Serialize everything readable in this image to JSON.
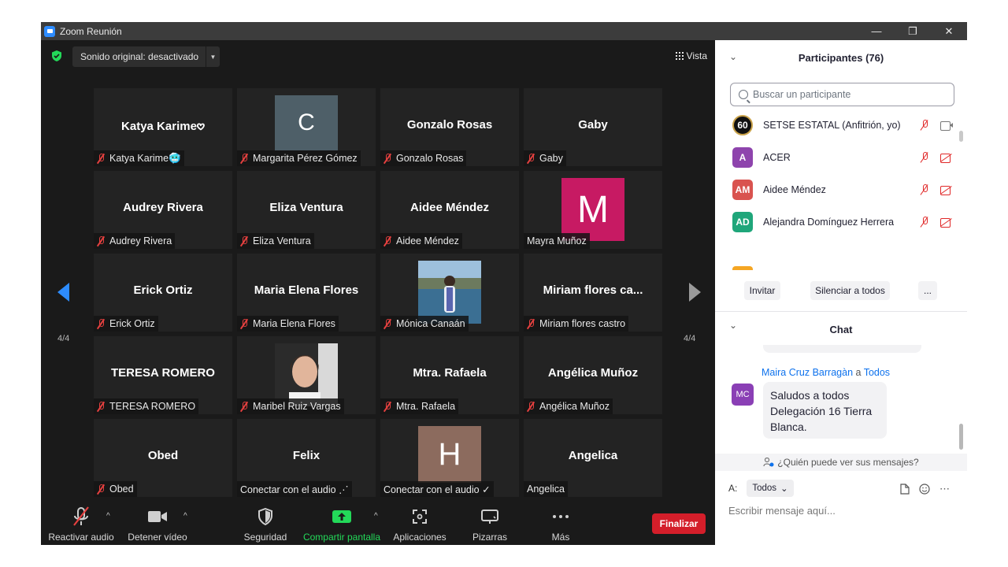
{
  "window": {
    "title": "Zoom Reunión",
    "controls": [
      "—",
      "❐",
      "✕"
    ]
  },
  "topbar": {
    "sound_label": "Sonido original: desactivado",
    "view_label": "Vista"
  },
  "grid": {
    "tiles": [
      {
        "name": "Katya Karime𖹭",
        "label": "Katya Karime🥶",
        "muted": true,
        "kind": "text"
      },
      {
        "name": "",
        "label": "Margarita Pérez Gómez",
        "muted": true,
        "kind": "avatar",
        "letter": "C",
        "color": "#4e5f68"
      },
      {
        "name": "Gonzalo Rosas",
        "label": "Gonzalo Rosas",
        "muted": true,
        "kind": "text"
      },
      {
        "name": "Gaby",
        "label": "Gaby",
        "muted": true,
        "kind": "text"
      },
      {
        "name": "Audrey Rivera",
        "label": "Audrey Rivera",
        "muted": true,
        "kind": "text"
      },
      {
        "name": "Eliza Ventura",
        "label": "Eliza Ventura",
        "muted": true,
        "kind": "text"
      },
      {
        "name": "Aidee Méndez",
        "label": "Aidee Méndez",
        "muted": true,
        "kind": "text"
      },
      {
        "name": "",
        "label": "Mayra Muñoz",
        "muted": false,
        "kind": "avatar",
        "letter": "M",
        "color": "#c71a63"
      },
      {
        "name": "Erick Ortiz",
        "label": "Erick Ortiz",
        "muted": true,
        "kind": "text"
      },
      {
        "name": "Maria Elena Flores",
        "label": "Maria Elena Flores",
        "muted": true,
        "kind": "text"
      },
      {
        "name": "",
        "label": "Mónica Canaán",
        "muted": true,
        "kind": "photo-lake"
      },
      {
        "name": "Miriam flores ca...",
        "label": "Miriam flores castro",
        "muted": true,
        "kind": "text"
      },
      {
        "name": "TERESA ROMERO",
        "label": "TERESA ROMERO",
        "muted": true,
        "kind": "text"
      },
      {
        "name": "",
        "label": "Maribel Ruiz Vargas",
        "muted": true,
        "kind": "photo-face"
      },
      {
        "name": "Mtra. Rafaela",
        "label": "Mtra. Rafaela",
        "muted": true,
        "kind": "text"
      },
      {
        "name": "Angélica Muñoz",
        "label": "Angélica Muñoz",
        "muted": true,
        "kind": "text"
      },
      {
        "name": "Obed",
        "label": "Obed",
        "muted": true,
        "kind": "text"
      },
      {
        "name": "Felix",
        "label": "Conectar con el audio ⋰",
        "muted": false,
        "kind": "text"
      },
      {
        "name": "",
        "label": "Conectar con el audio ✓",
        "muted": false,
        "kind": "avatar",
        "letter": "H",
        "color": "#8c6b5e"
      },
      {
        "name": "Angelica",
        "label": "Angelica",
        "muted": false,
        "kind": "text"
      }
    ],
    "page_left": "4/4",
    "page_right": "4/4"
  },
  "toolbar": {
    "audio": "Reactivar audio",
    "video": "Detener vídeo",
    "security": "Seguridad",
    "share": "Compartir pantalla",
    "apps": "Aplicaciones",
    "whiteboards": "Pizarras",
    "more": "Más",
    "end": "Finalizar"
  },
  "participants": {
    "title": "Participantes (76)",
    "search_placeholder": "Buscar un participante",
    "list": [
      {
        "initials": "60",
        "name": "SETSE ESTATAL (Anfitrión, yo)",
        "color": "#111111",
        "video_on": true
      },
      {
        "initials": "A",
        "name": "ACER",
        "color": "#8e44ad",
        "video_on": false
      },
      {
        "initials": "AM",
        "name": "Aidee Méndez",
        "color": "#d9534f",
        "video_on": false
      },
      {
        "initials": "AD",
        "name": "Alejandra Domínguez Herrera",
        "color": "#1fa67a",
        "video_on": false
      }
    ],
    "invite": "Invitar",
    "mute_all": "Silenciar a todos",
    "more": "..."
  },
  "chat": {
    "title": "Chat",
    "sender": "Maira Cruz Barragàn",
    "to_word": "a",
    "recipient": "Todos",
    "avatar": "MC",
    "message": "Saludos a todos Delegación 16 Tierra Blanca.",
    "who_can_see": "¿Quién puede ver sus mensajes?",
    "to_label": "A:",
    "to_value": "Todos",
    "input_placeholder": "Escribir mensaje aquí..."
  }
}
